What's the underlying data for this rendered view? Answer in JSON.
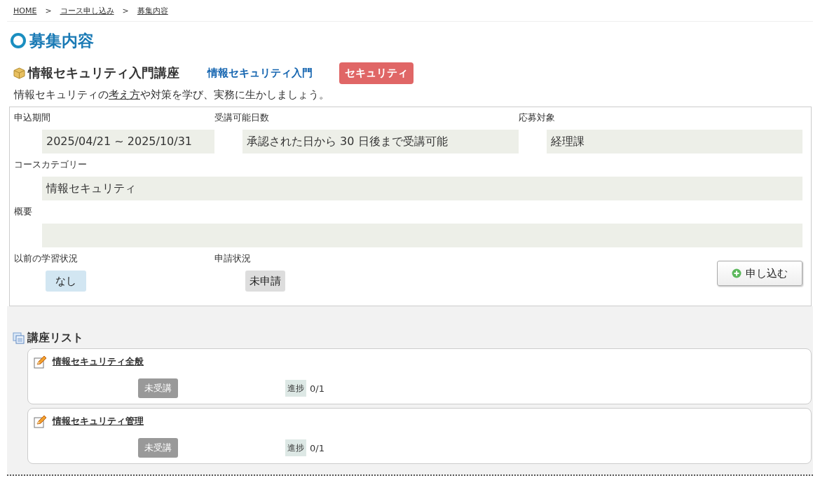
{
  "breadcrumb": [
    {
      "label": "HOME"
    },
    {
      "label": "コース申し込み"
    },
    {
      "label": "募集内容"
    }
  ],
  "breadcrumb_separator": ">",
  "page_title": "募集内容",
  "course": {
    "title": "情報セキュリティ入門講座",
    "subtitle": "情報セキュリティ入門",
    "tag": "セキュリティ"
  },
  "description": {
    "before": "情報セキュリティの",
    "link": "考え方",
    "after": "や対策を学び、実務に生かしましょう。"
  },
  "fields": [
    {
      "label": "申込期間",
      "value": "2025/04/21 ~ 2025/10/31"
    },
    {
      "label": "受講可能日数",
      "value": "承認された日から 30 日後まで受講可能"
    },
    {
      "label": "応募対象",
      "value": "経理課"
    },
    {
      "label": "コースカテゴリー",
      "value": "情報セキュリティ"
    },
    {
      "label": "概要"
    }
  ],
  "previous_status": {
    "label": "以前の学習状況",
    "value": "なし"
  },
  "application_status": {
    "label": "申請状況",
    "value": "未申請"
  },
  "apply_button": "申し込む",
  "lesson_list": {
    "title": "講座リスト",
    "items": [
      {
        "title": "情報セキュリティ全般",
        "status": "未受講",
        "progress_label": "進捗",
        "progress": "0/1"
      },
      {
        "title": "情報セキュリティ管理",
        "status": "未受講",
        "progress_label": "進捗",
        "progress": "0/1"
      }
    ]
  }
}
